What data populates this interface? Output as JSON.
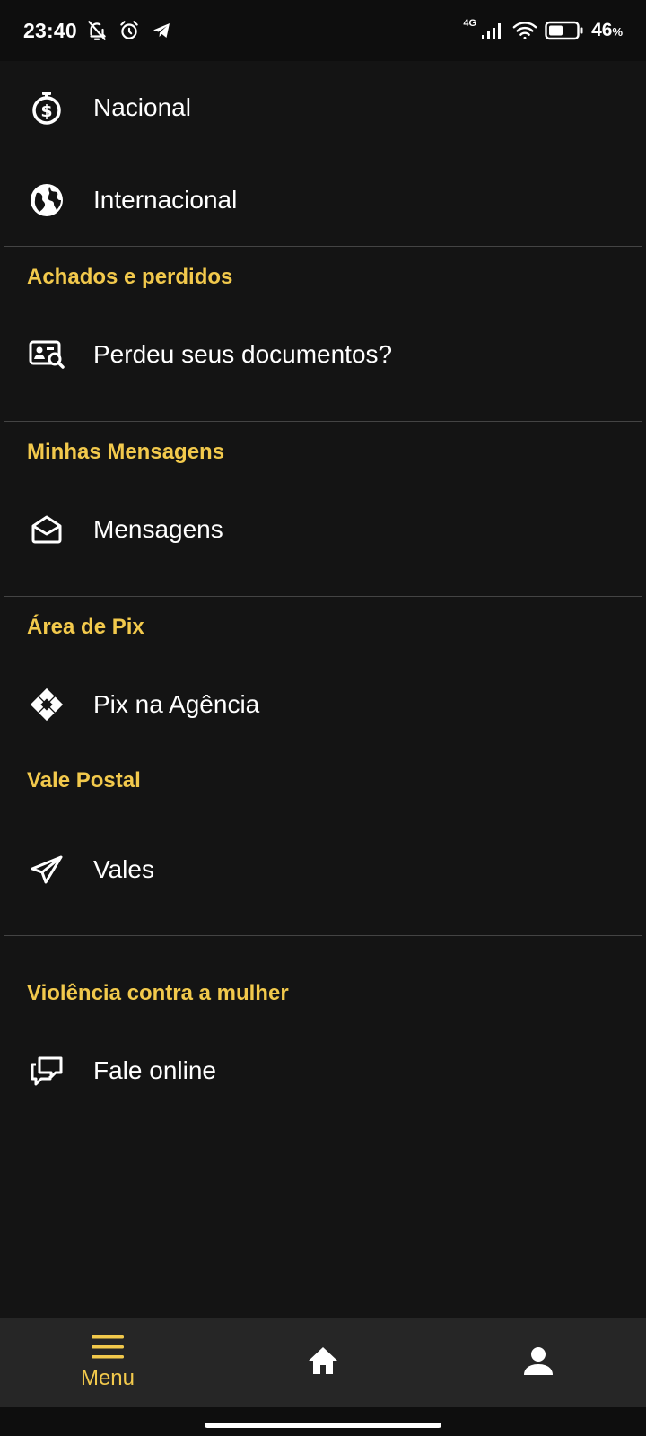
{
  "status_bar": {
    "time": "23:40",
    "network_type": "4G",
    "battery_percent": "46",
    "battery_unit": "%"
  },
  "menu": {
    "items_top": [
      {
        "label": "Nacional",
        "icon": "dollar-stopwatch-icon"
      },
      {
        "label": "Internacional",
        "icon": "globe-icon"
      }
    ],
    "sections": {
      "achados": {
        "title": "Achados e perdidos",
        "item": {
          "label": "Perdeu seus documentos?",
          "icon": "id-card-search-icon"
        }
      },
      "mensagens": {
        "title": "Minhas Mensagens",
        "item": {
          "label": "Mensagens",
          "icon": "envelope-open-icon"
        }
      },
      "pix": {
        "title": "Área de Pix",
        "item": {
          "label": "Pix na Agência",
          "icon": "pix-icon"
        }
      },
      "vale": {
        "title": "Vale Postal",
        "item": {
          "label": "Vales",
          "icon": "paper-plane-icon"
        }
      },
      "violencia": {
        "title": "Violência contra a mulher",
        "item": {
          "label": "Fale online",
          "icon": "chat-bubbles-icon"
        }
      }
    }
  },
  "bottom_nav": {
    "menu_label": "Menu",
    "items": [
      "menu",
      "home",
      "profile"
    ]
  },
  "colors": {
    "background": "#141414",
    "accent": "#f2c94c",
    "nav_background": "#262626",
    "divider": "#444444"
  }
}
